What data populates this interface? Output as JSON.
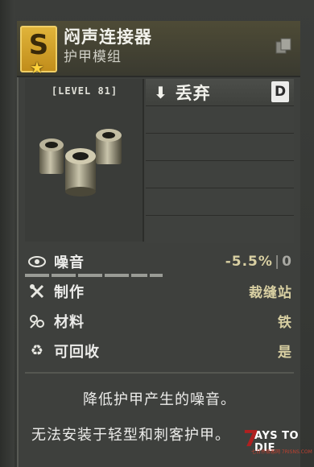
{
  "item": {
    "name": "闷声连接器",
    "type": "护甲模组",
    "tier": "S",
    "level": "[LEVEL 81]"
  },
  "actions": {
    "primary_label": "丢弃",
    "primary_key": "D"
  },
  "stats": [
    {
      "label": "噪音",
      "value": "-5.5%",
      "base": "0",
      "icon": "eye-icon"
    },
    {
      "label": "制作",
      "value": "裁缝站",
      "icon": "crafting-icon"
    },
    {
      "label": "材料",
      "value": "铁",
      "icon": "materials-icon"
    },
    {
      "label": "可回收",
      "value": "是",
      "icon": "recycle-icon"
    }
  ],
  "description": {
    "line1": "降低护甲产生的噪音。",
    "line2": "无法安装于轻型和刺客护甲。"
  },
  "watermark": {
    "digit": "7",
    "title": "AYS TO DIE",
    "sub": "七日杀极客网 7RISNS.COM"
  },
  "colors": {
    "tier_gold": "#d4a42a",
    "stat_value": "#d8cfa2",
    "panel_bg": "#3e403d"
  }
}
